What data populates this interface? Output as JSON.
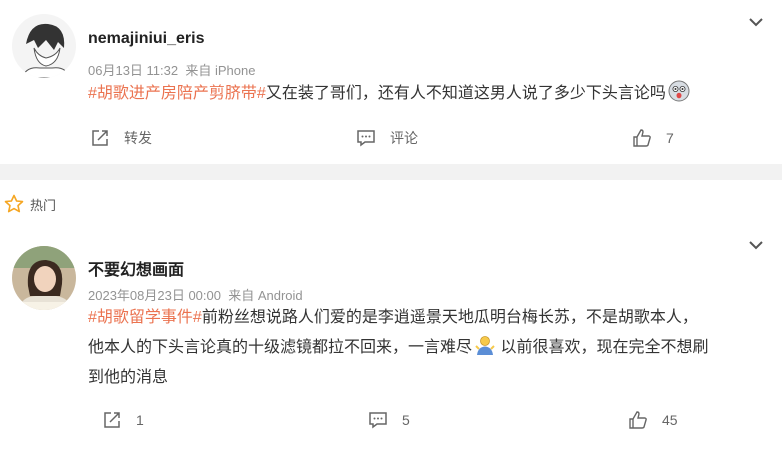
{
  "comments": [
    {
      "username": "nemajiniui_eris",
      "time": "06月13日 11:32",
      "source": "来自 iPhone",
      "hashtag": "#胡歌进产房陪产剪脐带#",
      "text": "又在装了哥们，还有人不知道这男人说了多少下头言论吗",
      "emoji_icon": "shocked-dog-emoji-icon",
      "repost_label": "转发",
      "comment_label": "评论",
      "like_count": "7"
    },
    {
      "username": "不要幻想画面",
      "time": "2023年08月23日 00:00",
      "source": "来自 Android",
      "hashtag": "#胡歌留学事件#",
      "text_line1": "前粉丝想说路人们爱的是李逍遥景天地瓜明台梅长苏，不是胡歌本人，",
      "text_line2a": "他本人的下头言论真的十级滤镜都拉不回来，一言难尽",
      "text_line2b": " 以前很喜欢，现在完全不想刷",
      "text_line3": "到他的消息",
      "emoji_icon": "shrug-person-emoji-icon",
      "repost_count": "1",
      "comment_count": "5",
      "like_count": "45"
    }
  ],
  "hot_section": {
    "label": "热门"
  },
  "colors": {
    "accent": "#eb7350",
    "meta": "#939393",
    "separator": "#f2f2f2"
  }
}
